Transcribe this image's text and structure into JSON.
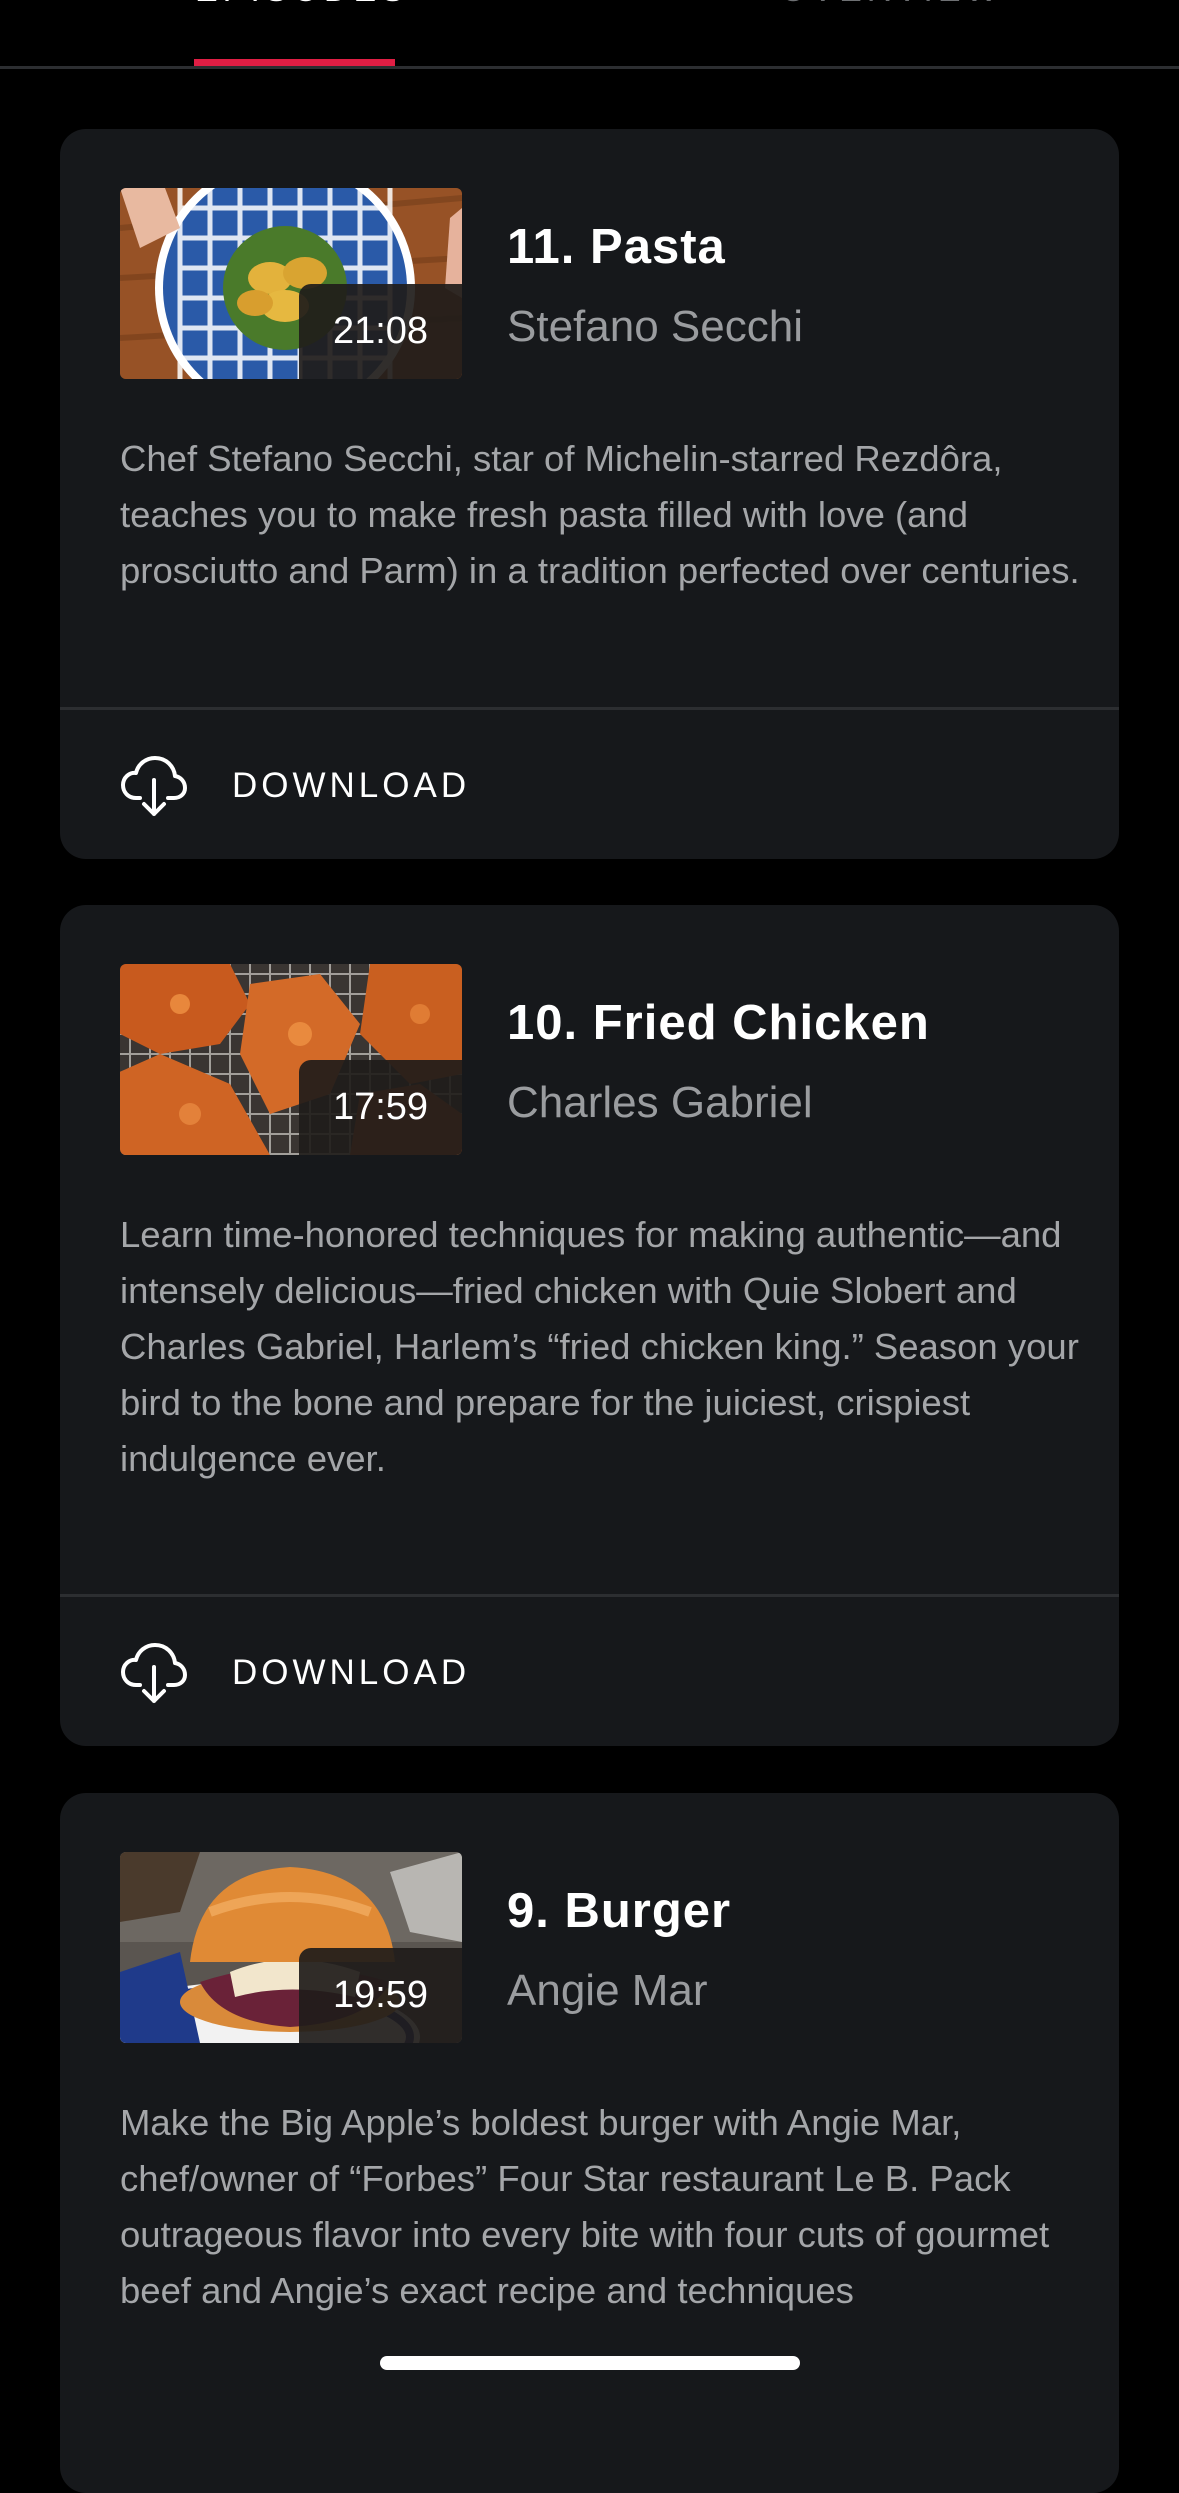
{
  "tabs": {
    "episodes": "EPISODES",
    "overview": "OVERVIEW",
    "active": "episodes"
  },
  "episodes": [
    {
      "title": "11. Pasta",
      "chef": "Stefano Secchi",
      "duration": "21:08",
      "description": "Chef Stefano Secchi, star of Michelin-starred Rezdôra, teaches you to make fresh pasta filled with love (and prosciutto and Parm) in a tradition perfected over centuries.",
      "download_label": "DOWNLOAD",
      "download_icon": "cloud-download-icon"
    },
    {
      "title": "10. Fried Chicken",
      "chef": "Charles Gabriel",
      "duration": "17:59",
      "description": "Learn time-honored techniques for making authentic—and intensely delicious—fried chicken with Quie Slobert and Charles Gabriel, Harlem’s “fried chicken king.” Season your bird to the bone and prepare for the juiciest, crispiest indulgence ever.",
      "download_label": "DOWNLOAD",
      "download_icon": "cloud-download-icon"
    },
    {
      "title": "9. Burger",
      "chef": "Angie Mar",
      "duration": "19:59",
      "description": "Make the Big Apple’s boldest burger with Angie Mar, chef/owner of “Forbes” Four Star restaurant Le B. Pack outrageous flavor into every bite with four cuts of gourmet beef and Angie’s exact recipe and techniques"
    }
  ],
  "colors": {
    "background": "#000000",
    "card": "#16181b",
    "accent": "#e01e44",
    "divider": "#2c2e31",
    "secondary_text": "#9a9c9f"
  }
}
